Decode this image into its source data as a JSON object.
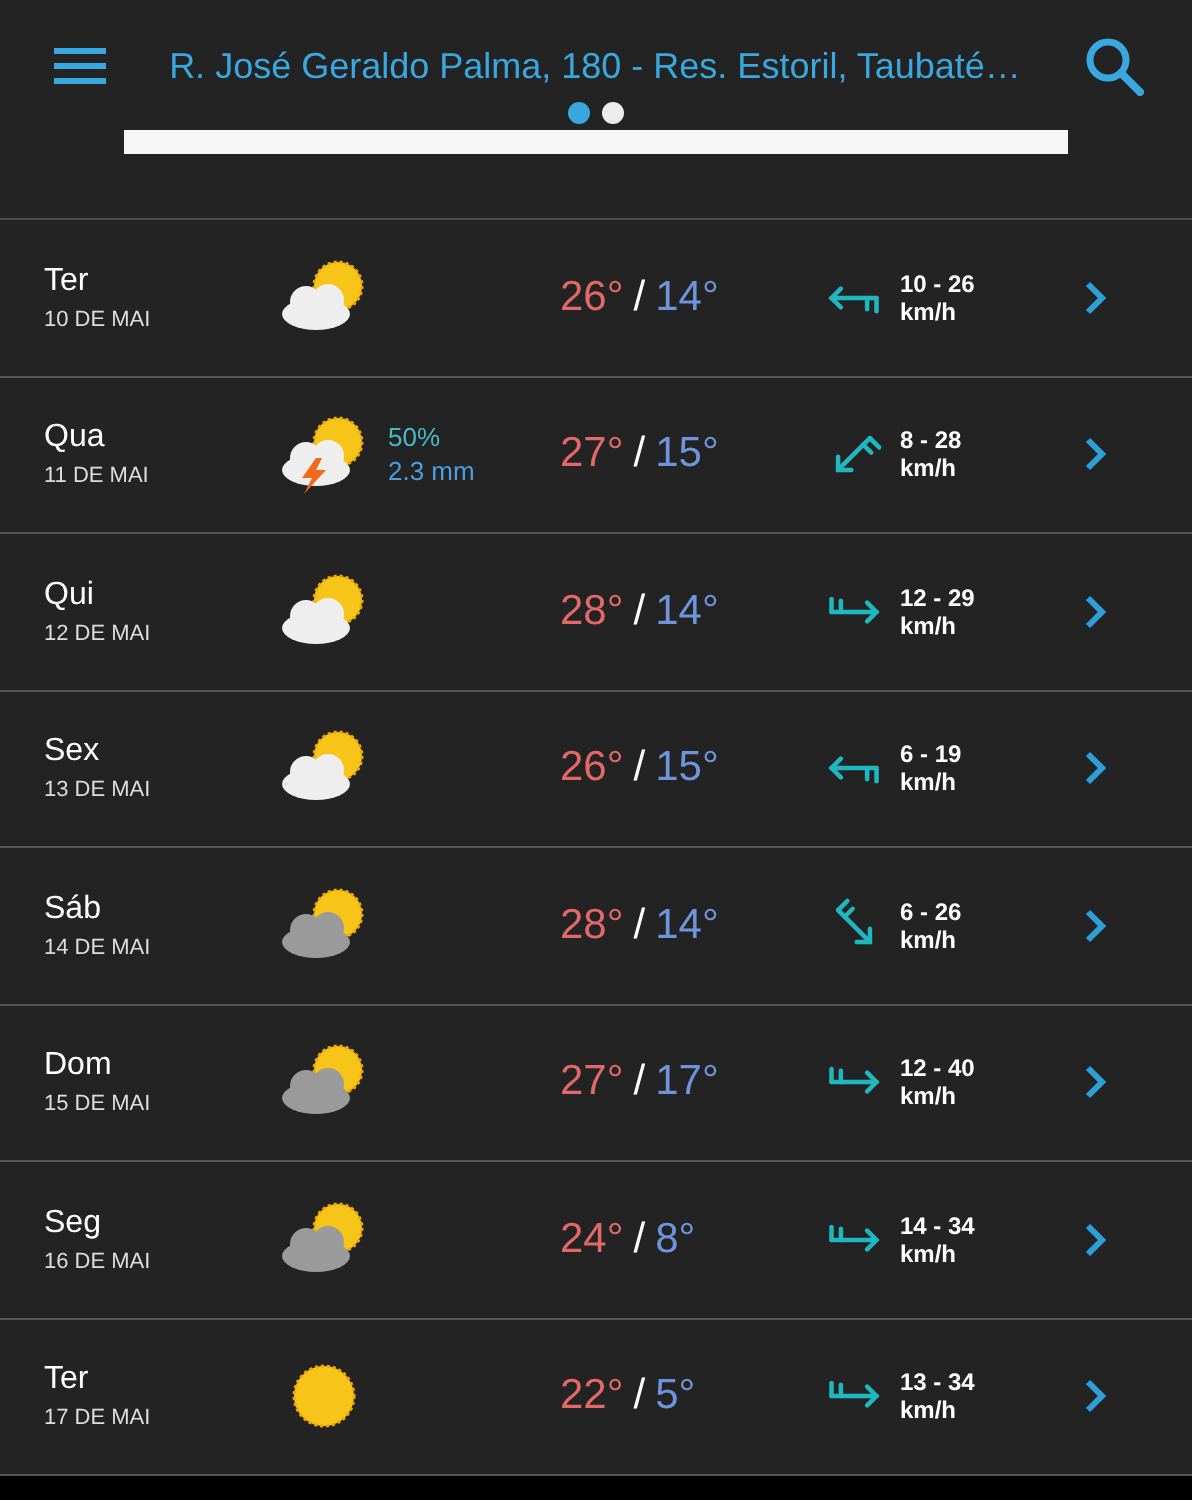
{
  "header": {
    "title": "R. José Geraldo Palma, 180 - Res. Estoril, Taubaté…",
    "pages": [
      {
        "selected": true
      },
      {
        "selected": false
      }
    ]
  },
  "days": [
    {
      "day": "Ter",
      "date": "10 DE MAI",
      "kind": "partly_cloudy",
      "high": "26°",
      "separator": "/",
      "low": "14°",
      "wind": {
        "kind": "west",
        "speed": "10 - 26",
        "unit": "km/h"
      }
    },
    {
      "day": "Qua",
      "date": "11 DE MAI",
      "kind": "storm",
      "rain_chance": "50%",
      "rain_amount": "2.3 mm",
      "high": "27°",
      "separator": "/",
      "low": "15°",
      "wind": {
        "kind": "southwest",
        "speed": "8 - 28",
        "unit": "km/h"
      }
    },
    {
      "day": "Qui",
      "date": "12 DE MAI",
      "kind": "partly_cloudy",
      "high": "28°",
      "separator": "/",
      "low": "14°",
      "wind": {
        "kind": "east",
        "speed": "12 - 29",
        "unit": "km/h"
      }
    },
    {
      "day": "Sex",
      "date": "13 DE MAI",
      "kind": "partly_cloudy",
      "high": "26°",
      "separator": "/",
      "low": "15°",
      "wind": {
        "kind": "west",
        "speed": "6 - 19",
        "unit": "km/h"
      }
    },
    {
      "day": "Sáb",
      "date": "14 DE MAI",
      "kind": "cloudy",
      "high": "28°",
      "separator": "/",
      "low": "14°",
      "wind": {
        "kind": "southeast",
        "speed": "6 - 26",
        "unit": "km/h"
      }
    },
    {
      "day": "Dom",
      "date": "15 DE MAI",
      "kind": "cloudy",
      "high": "27°",
      "separator": "/",
      "low": "17°",
      "wind": {
        "kind": "east",
        "speed": "12 - 40",
        "unit": "km/h"
      }
    },
    {
      "day": "Seg",
      "date": "16 DE MAI",
      "kind": "cloudy",
      "high": "24°",
      "separator": "/",
      "low": "8°",
      "wind": {
        "kind": "east",
        "speed": "14 - 34",
        "unit": "km/h"
      }
    },
    {
      "day": "Ter",
      "date": "17 DE MAI",
      "kind": "sunny",
      "high": "22°",
      "separator": "/",
      "low": "5°",
      "wind": {
        "kind": "east",
        "speed": "13 - 34",
        "unit": "km/h"
      }
    }
  ]
}
